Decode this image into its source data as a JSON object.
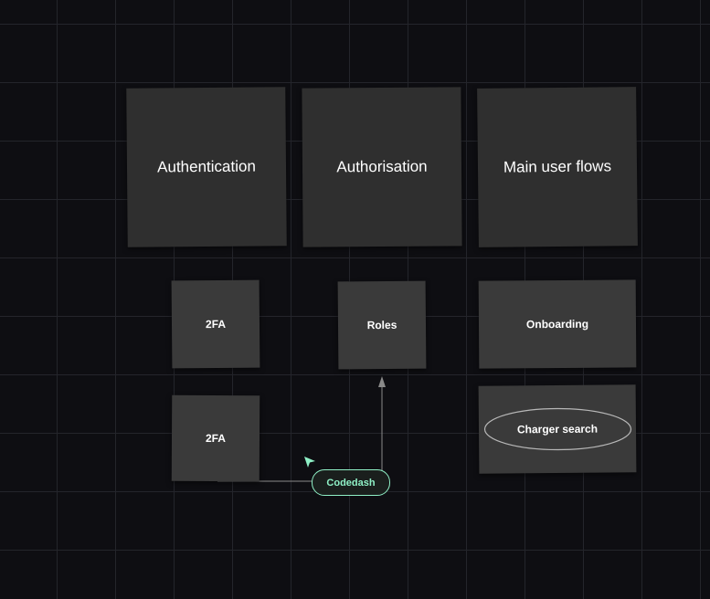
{
  "board": {
    "background": "#0e0e12",
    "grid_color": "#24252b"
  },
  "notes": {
    "authentication": "Authentication",
    "authorisation": "Authorisation",
    "main_user_flows": "Main user flows",
    "twofa_1": "2FA",
    "roles": "Roles",
    "onboarding": "Onboarding",
    "twofa_2": "2FA",
    "charger_search": "Charger search"
  },
  "collaborator": {
    "name": "Codedash",
    "color": "#8ff0c6",
    "icon": "cursor-arrow-icon"
  },
  "connector": {
    "color": "#8a8a8a",
    "arrowhead": "up-arrow-icon"
  }
}
